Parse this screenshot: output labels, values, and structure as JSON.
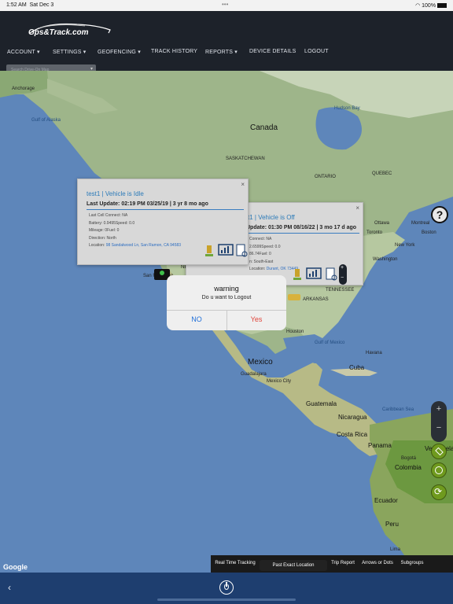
{
  "status_bar": {
    "time": "1:52 AM",
    "date": "Sat Dec 3",
    "center": "•••",
    "battery": "100%"
  },
  "header": {
    "logo_text": "Gps&Track.com",
    "nav": [
      {
        "label": "ACCOUNT",
        "caret": true
      },
      {
        "label": "SETTINGS",
        "caret": true
      },
      {
        "label": "GEOFENCING",
        "caret": true
      },
      {
        "label": "TRACK HISTORY",
        "caret": false
      },
      {
        "label": "REPORTS",
        "caret": true
      },
      {
        "label": "DEVICE DETAILS",
        "caret": false
      },
      {
        "label": "LOGOUT",
        "caret": false
      }
    ],
    "search_placeholder": "Search Drive-On Map"
  },
  "map": {
    "labels": {
      "anchorage": "Anchorage",
      "gulf_alaska": "Gulf of Alaska",
      "canada": "Canada",
      "saskatchewan": "SASKATCHEWAN",
      "hudson_bay": "Hudson Bay",
      "ontario": "ONTARIO",
      "quebec": "QUEBEC",
      "ottawa": "Ottawa",
      "toronto": "Toronto",
      "montreal": "Montreal",
      "new_york": "New York",
      "boston": "Boston",
      "washington": "Washington",
      "tennessee": "TENNESSEE",
      "arkansas": "ARKANSAS",
      "houston": "Houston",
      "nevada": "NEVADA",
      "san_francisco": "San Francisco",
      "mexico": "Mexico",
      "guadalajara": "Guadalajara",
      "mexico_city": "Mexico City",
      "cuba": "Cuba",
      "havana": "Havana",
      "gulf_mexico": "Gulf of Mexico",
      "guatemala": "Guatemala",
      "nicaragua": "Nicaragua",
      "costa_rica": "Costa Rica",
      "panama": "Panama",
      "caribbean": "Caribbean Sea",
      "venezuela": "Venezuela",
      "colombia": "Colombia",
      "bogota": "Bogotá",
      "ecuador": "Ecuador",
      "peru": "Peru",
      "lima": "Lima",
      "google": "Google"
    }
  },
  "popup_idle": {
    "title": "test1 | Vehicle is Idle",
    "update": "Last Update: 02:19 PM 03/25/19 | 3 yr 8 mo ago",
    "lines": [
      "Last Cell Connect: NA",
      "Battery: 0.9495Speed: 0.0",
      "Mileage: 0Fuel: 0",
      "Direction: North"
    ],
    "location_label": "Location:",
    "location_value": "98 Sandalwood Ln, San Ramon, CA 94583",
    "close": "×"
  },
  "popup_off": {
    "title": "t1 | Vehicle is Off",
    "update": "Update: 01:30 PM 08/16/22 | 3 mo 17 d ago",
    "lines": [
      "Connect: NA",
      "2.6599Speed: 0.0",
      "86.74Fuel: 0",
      "n: South-East"
    ],
    "location_label": "Location:",
    "location_value": "Durant, OK 73449",
    "close": "×"
  },
  "dialog": {
    "title": "warning",
    "message": "Do u want to Logout",
    "no": "NO",
    "yes": "Yes"
  },
  "controls": {
    "help": "?",
    "zoom_in": "+",
    "zoom_out": "−"
  },
  "bottom_tabs": [
    "Real Time Tracking",
    "Past Exact Location",
    "Trip Report",
    "Arrows or Dots",
    "Subgroups"
  ],
  "footer": {
    "back": "‹"
  },
  "colors": {
    "accent_blue": "#2b7ab8",
    "header_bg": "#1d222a",
    "footer_bg": "#1e3e6f",
    "yes_red": "#e0463c",
    "no_blue": "#1f6fd9",
    "control_green": "#6f9a1e"
  }
}
